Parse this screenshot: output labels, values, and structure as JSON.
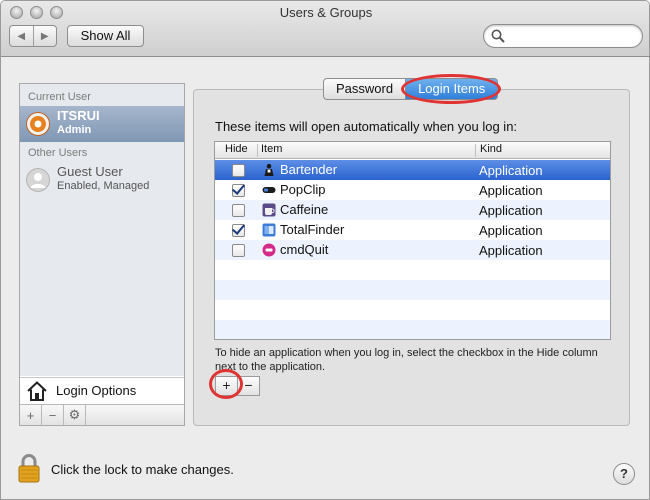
{
  "window": {
    "title": "Users & Groups"
  },
  "toolbar": {
    "back_glyph": "◀",
    "forward_glyph": "▶",
    "show_all_label": "Show All",
    "search_placeholder": ""
  },
  "sidebar": {
    "current_user_header": "Current User",
    "current_user": {
      "name": "ITSRUI",
      "role": "Admin"
    },
    "other_users_header": "Other Users",
    "other_users": [
      {
        "name": "Guest User",
        "role": "Enabled, Managed"
      }
    ],
    "login_options_label": "Login Options",
    "buttons": [
      {
        "label": "+"
      },
      {
        "label": "−"
      },
      {
        "label": "⚙"
      }
    ]
  },
  "tabs": [
    {
      "label": "Password",
      "active": false
    },
    {
      "label": "Login Items",
      "active": true
    }
  ],
  "login_items": {
    "intro": "These items will open automatically when you log in:",
    "columns": {
      "hide": "Hide",
      "item": "Item",
      "kind": "Kind"
    },
    "rows": [
      {
        "name": "Bartender",
        "kind": "Application",
        "hidden": false,
        "selected": true,
        "icon": "bartender-icon"
      },
      {
        "name": "PopClip",
        "kind": "Application",
        "hidden": true,
        "selected": false,
        "icon": "popclip-icon"
      },
      {
        "name": "Caffeine",
        "kind": "Application",
        "hidden": false,
        "selected": false,
        "icon": "caffeine-icon"
      },
      {
        "name": "TotalFinder",
        "kind": "Application",
        "hidden": true,
        "selected": false,
        "icon": "totalfinder-icon"
      },
      {
        "name": "cmdQuit",
        "kind": "Application",
        "hidden": false,
        "selected": false,
        "icon": "cmdquit-icon"
      }
    ],
    "hint": "To hide an application when you log in, select the checkbox in the Hide column next to the application.",
    "add_label": "+",
    "remove_label": "−"
  },
  "footer": {
    "lock_text": "Click the lock to make changes.",
    "help_label": "?"
  },
  "colors": {
    "selection": "#2a62cf",
    "annotation": "#e03434",
    "tab_active": "#2f7fd9"
  }
}
